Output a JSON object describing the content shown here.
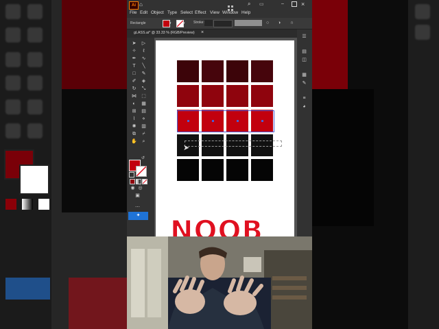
{
  "app": {
    "logo_text": "Ai",
    "menu": [
      "File",
      "Edit",
      "Object",
      "Type",
      "Select",
      "Effect",
      "View",
      "Window",
      "Help"
    ],
    "toolbar_label": "Rectangle",
    "stroke_label": "Stroke:",
    "doc_tab": "gLASS.ai* @ 33.33 % (RGB/Preview)",
    "close_tab": "×"
  },
  "overlay": {
    "caption": "NOOB"
  },
  "colors": {
    "row1": [
      "#3c0409",
      "#46050c",
      "#3c0409",
      "#46050c"
    ],
    "row2": "#8f040d",
    "row3": "#c2000e",
    "row4": "#111111",
    "row5": "#050505",
    "accent": "#e01020",
    "selection": "#4b5fd6"
  }
}
